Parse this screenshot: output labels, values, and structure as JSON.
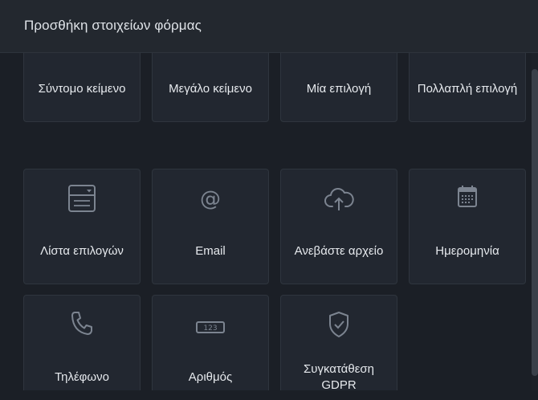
{
  "header": {
    "title": "Προσθήκη στοιχείων φόρμας"
  },
  "tiles": [
    {
      "label": "Σύντομο κείμενο",
      "icon": "short-text-icon"
    },
    {
      "label": "Μεγάλο κείμενο",
      "icon": "long-text-icon"
    },
    {
      "label": "Μία επιλογή",
      "icon": "single-choice-icon"
    },
    {
      "label": "Πολλαπλή επιλογή",
      "icon": "multiple-choice-icon"
    },
    {
      "label": "Λίστα επιλογών",
      "icon": "dropdown-list-icon"
    },
    {
      "label": "Email",
      "icon": "at-sign-icon"
    },
    {
      "label": "Ανεβάστε αρχείο",
      "icon": "cloud-upload-icon"
    },
    {
      "label": "Ημερομηνία",
      "icon": "calendar-icon"
    },
    {
      "label": "Τηλέφωνο",
      "icon": "phone-icon"
    },
    {
      "label": "Αριθμός",
      "icon": "number-field-icon"
    },
    {
      "label": "Συγκατάθεση GDPR",
      "icon": "shield-check-icon"
    }
  ],
  "number_icon_text": "123",
  "colors": {
    "icon": "#7c8490",
    "text": "#e6e9ed",
    "tile": "#222730",
    "background": "#1b1f26"
  }
}
